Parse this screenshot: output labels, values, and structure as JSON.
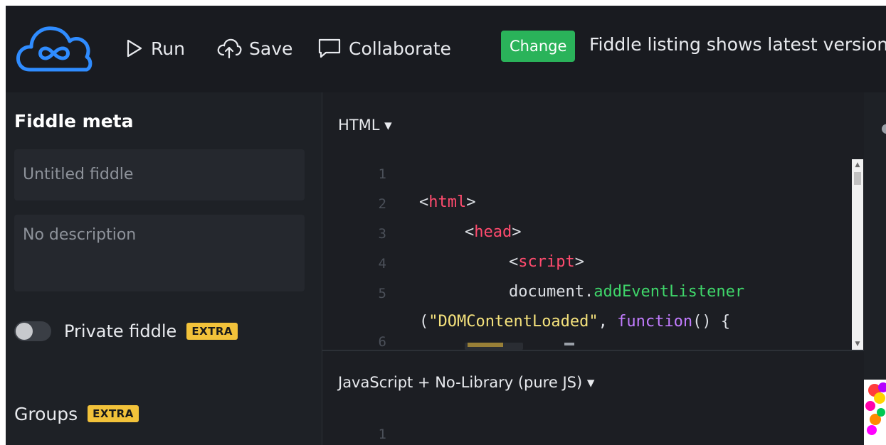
{
  "toolbar": {
    "run_label": "Run",
    "save_label": "Save",
    "collaborate_label": "Collaborate",
    "change_badge": "Change",
    "listing_text": "Fiddle listing shows latest version"
  },
  "sidebar": {
    "title": "Fiddle meta",
    "title_placeholder": "Untitled fiddle",
    "description_placeholder": "No description",
    "private_label": "Private fiddle",
    "private_enabled": false,
    "private_badge": "EXTRA",
    "groups_label": "Groups",
    "groups_badge": "EXTRA"
  },
  "editors": {
    "html": {
      "label": "HTML ▾",
      "line_numbers": [
        "1",
        "2",
        "3",
        "4",
        "5",
        "6"
      ],
      "code": {
        "l2_open": "<",
        "l2_tag": "html",
        "l2_close": ">",
        "l3_open": "<",
        "l3_tag": "head",
        "l3_close": ">",
        "l4_open": "<",
        "l4_tag": "script",
        "l4_close": ">",
        "l5_obj": "document.",
        "l5_fn": "addEventListener",
        "l5b_open": "(",
        "l5b_str": "\"DOMContentLoaded\"",
        "l5b_comma": ", ",
        "l5b_kw": "function",
        "l5b_end": "() {"
      }
    },
    "javascript": {
      "label": "JavaScript + No-Library (pure JS) ▾",
      "line_numbers": [
        "1"
      ]
    }
  },
  "colors": {
    "accent_blue": "#2f8cff",
    "change_green": "#2ab35a",
    "extra_yellow": "#f2c23a",
    "tag_red": "#ff4b6e",
    "fn_green": "#3fd66a",
    "string_yellow": "#f5e27c",
    "keyword_purple": "#c27cff"
  },
  "icons": {
    "logo": "cloud-infinity-logo",
    "run": "play-icon",
    "save": "cloud-upload-icon",
    "collaborate": "chat-bubble-icon"
  }
}
